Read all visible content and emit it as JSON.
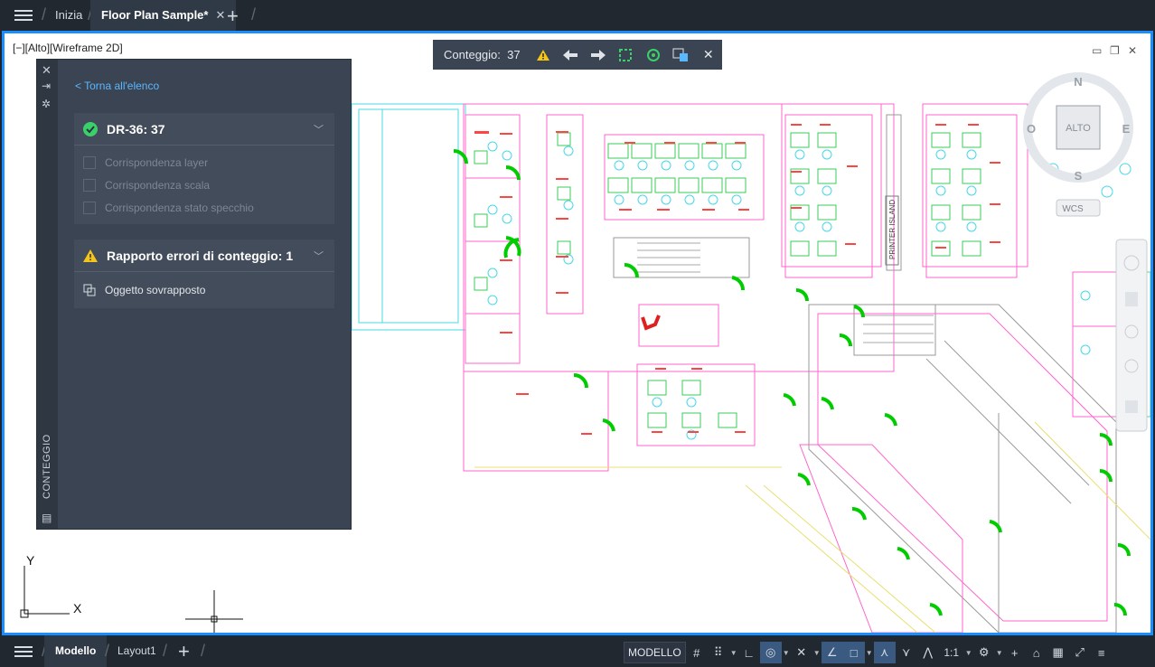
{
  "tabs": [
    {
      "label": "Inizia",
      "active": false
    },
    {
      "label": "Floor Plan Sample*",
      "active": true
    }
  ],
  "viewport": {
    "label": "[−][Alto][Wireframe 2D]"
  },
  "count_toolbar": {
    "label": "Conteggio:",
    "count": "37"
  },
  "viewcube": {
    "n": "N",
    "s": "S",
    "e": "E",
    "o": "O",
    "top": "ALTO",
    "wcs": "WCS"
  },
  "ucs": {
    "x": "X",
    "y": "Y"
  },
  "plan_text": {
    "printer": "PRINTER ISLAND"
  },
  "panel": {
    "title": "CONTEGGIO",
    "back_link": "< Torna all'elenco",
    "block_item": {
      "name": "DR-36: 37",
      "checks": [
        "Corrispondenza layer",
        "Corrispondenza scala",
        "Corrispondenza stato specchio"
      ]
    },
    "error_item": {
      "name": "Rapporto errori di conteggio: 1",
      "issue": "Oggetto sovrapposto"
    }
  },
  "layout_tabs": [
    {
      "label": "Modello",
      "active": true
    },
    {
      "label": "Layout1",
      "active": false
    }
  ],
  "status": {
    "model": "MODELLO",
    "scale": "1:1"
  },
  "colors": {
    "accent": "#1a8dff",
    "panel_bg": "#3b4453",
    "link": "#59b8ff",
    "door_green": "#00cc00",
    "error_red": "#e02020"
  }
}
